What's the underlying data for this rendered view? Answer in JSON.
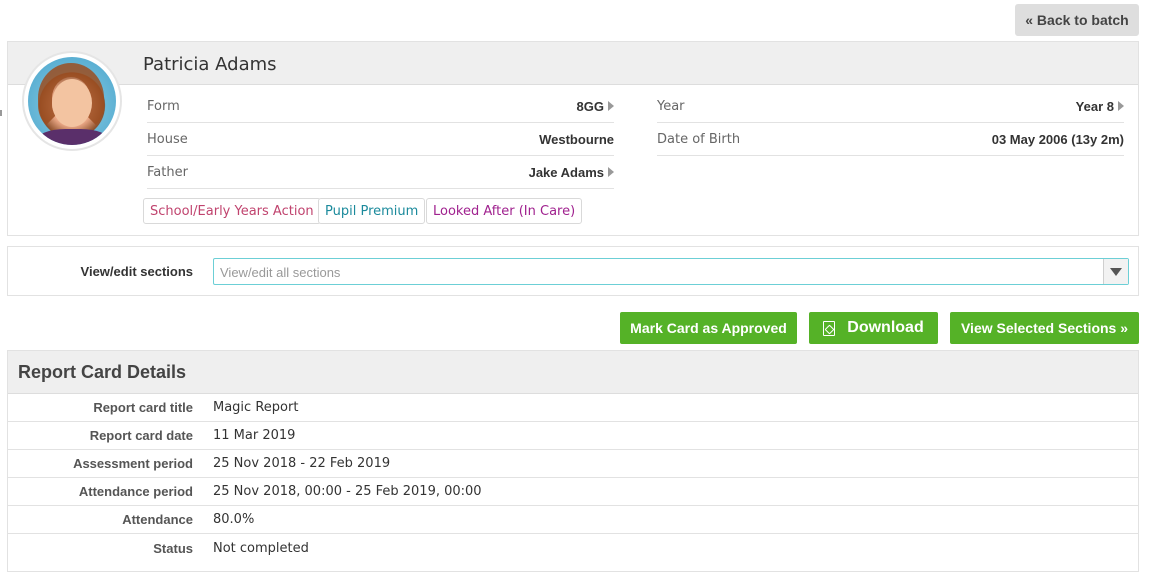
{
  "header": {
    "back_label": "« Back to batch"
  },
  "student": {
    "name": "Patricia Adams",
    "fields_left": [
      {
        "label": "Form",
        "value": "8GG",
        "link": true
      },
      {
        "label": "House",
        "value": "Westbourne",
        "link": false
      },
      {
        "label": "Father",
        "value": "Jake Adams",
        "link": true
      }
    ],
    "fields_right": [
      {
        "label": "Year",
        "value": "Year 8",
        "link": true
      },
      {
        "label": "Date of Birth",
        "value": "03 May 2006 (13y 2m)",
        "link": false
      }
    ],
    "tags": [
      {
        "label": "School/Early Years Action",
        "color": "#c0436e"
      },
      {
        "label": "Pupil Premium",
        "color": "#1b8a9c"
      },
      {
        "label": "Looked After (In Care)",
        "color": "#a0228f"
      }
    ]
  },
  "sections": {
    "label": "View/edit sections",
    "placeholder": "View/edit all sections"
  },
  "actions": {
    "approve_label": "Mark Card as Approved",
    "download_label": "Download",
    "view_selected_label": "View Selected Sections »"
  },
  "details": {
    "title": "Report Card Details",
    "rows": [
      {
        "key": "Report card title",
        "value": "Magic Report"
      },
      {
        "key": "Report card date",
        "value": "11 Mar 2019"
      },
      {
        "key": "Assessment period",
        "value": "25 Nov 2018 - 22 Feb 2019"
      },
      {
        "key": "Attendance period",
        "value": "25 Nov 2018, 00:00 - 25 Feb 2019, 00:00"
      },
      {
        "key": "Attendance",
        "value": "80.0%"
      },
      {
        "key": "Status",
        "value": "Not completed"
      }
    ]
  },
  "colors": {
    "accent_green": "#55b227",
    "select_border": "#6ccfd6"
  }
}
